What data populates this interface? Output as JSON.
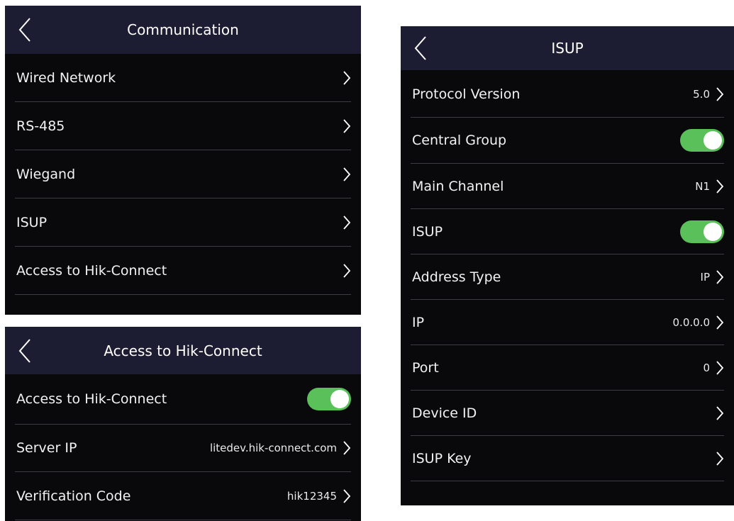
{
  "icons": {
    "back": "chevron-left-icon",
    "chevron": "chevron-right-icon"
  },
  "colors": {
    "header_bg": "#1c1c33",
    "panel_bg": "#09090c",
    "toggle_on": "#5ac05a",
    "divider": "#3c3c42"
  },
  "communication": {
    "title": "Communication",
    "items": [
      {
        "label": "Wired Network"
      },
      {
        "label": "RS-485"
      },
      {
        "label": "Wiegand"
      },
      {
        "label": "ISUP"
      },
      {
        "label": "Access to Hik-Connect"
      }
    ]
  },
  "hik_connect": {
    "title": "Access to Hik-Connect",
    "items": [
      {
        "label": "Access to Hik-Connect",
        "toggle": true
      },
      {
        "label": "Server IP",
        "value": "litedev.hik-connect.com"
      },
      {
        "label": "Verification Code",
        "value": "hik12345"
      }
    ]
  },
  "isup": {
    "title": "ISUP",
    "items": [
      {
        "label": "Protocol Version",
        "value": "5.0"
      },
      {
        "label": "Central Group",
        "toggle": true
      },
      {
        "label": "Main Channel",
        "value": "N1"
      },
      {
        "label": "ISUP",
        "toggle": true
      },
      {
        "label": "Address Type",
        "value": "IP"
      },
      {
        "label": "IP",
        "value": "0.0.0.0"
      },
      {
        "label": "Port",
        "value": "0"
      },
      {
        "label": "Device ID",
        "value": ""
      },
      {
        "label": "ISUP Key",
        "value": ""
      }
    ]
  }
}
